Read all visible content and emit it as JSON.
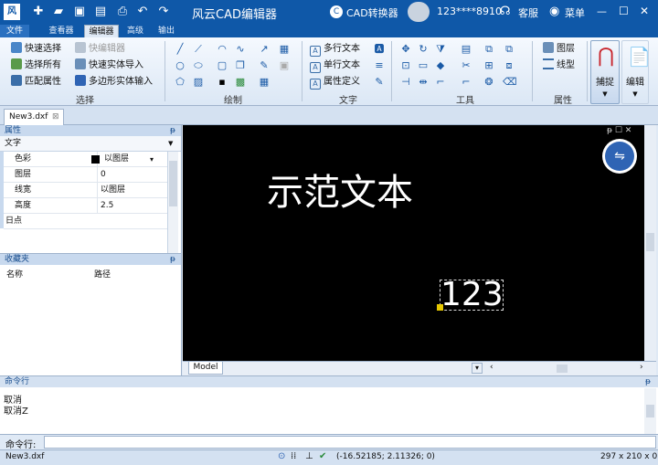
{
  "app": {
    "title": "风云CAD编辑器",
    "converter": "CAD转换器",
    "user": "123****8910",
    "service": "客服",
    "menu": "菜单",
    "minimize": "—",
    "maximize": "☐",
    "close": "✕"
  },
  "menus": [
    "文件",
    "查看器",
    "编辑器",
    "高级",
    "输出"
  ],
  "ribbon": {
    "select": {
      "quick_select": "快速选择",
      "select_all": "选择所有",
      "match_props": "匹配属性",
      "quick_editor": "快编辑器",
      "quick_entity_import": "快速实体导入",
      "polygon_entity_input": "多边形实体输入",
      "label": "选择"
    },
    "draw": {
      "label": "绘制"
    },
    "text": {
      "mtext": "多行文本",
      "stext": "单行文本",
      "attdef": "属性定义",
      "label": "文字"
    },
    "tools": {
      "label": "工具"
    },
    "props": {
      "layer": "图层",
      "linetype": "线型",
      "label": "属性"
    },
    "snap": "捕捉",
    "edit": "编辑"
  },
  "doc_tab": {
    "name": "New3.dxf",
    "close": "⊠"
  },
  "properties": {
    "title": "属性",
    "pin": "ᵽ",
    "dropdown": "文字",
    "rows": [
      {
        "name": "色彩",
        "value": "以图层"
      },
      {
        "name": "图层",
        "value": "0"
      },
      {
        "name": "线宽",
        "value": "以图层"
      },
      {
        "name": "高度",
        "value": "2.5"
      }
    ],
    "section": "日点"
  },
  "favorites": {
    "title": "收藏夹",
    "pin": "ᵽ",
    "col_name": "名称",
    "col_path": "路径"
  },
  "canvas": {
    "demo_text": "示范文本",
    "num_text": "123",
    "model_tab": "Model"
  },
  "command": {
    "title": "命令行",
    "pin": "ᵽ",
    "history": [
      "取消",
      "取消Z"
    ],
    "prompt": "命令行:"
  },
  "status": {
    "file": "New3.dxf",
    "coords": "(-16.52185; 2.11326; 0)",
    "size": "297 x 210 x 0"
  }
}
